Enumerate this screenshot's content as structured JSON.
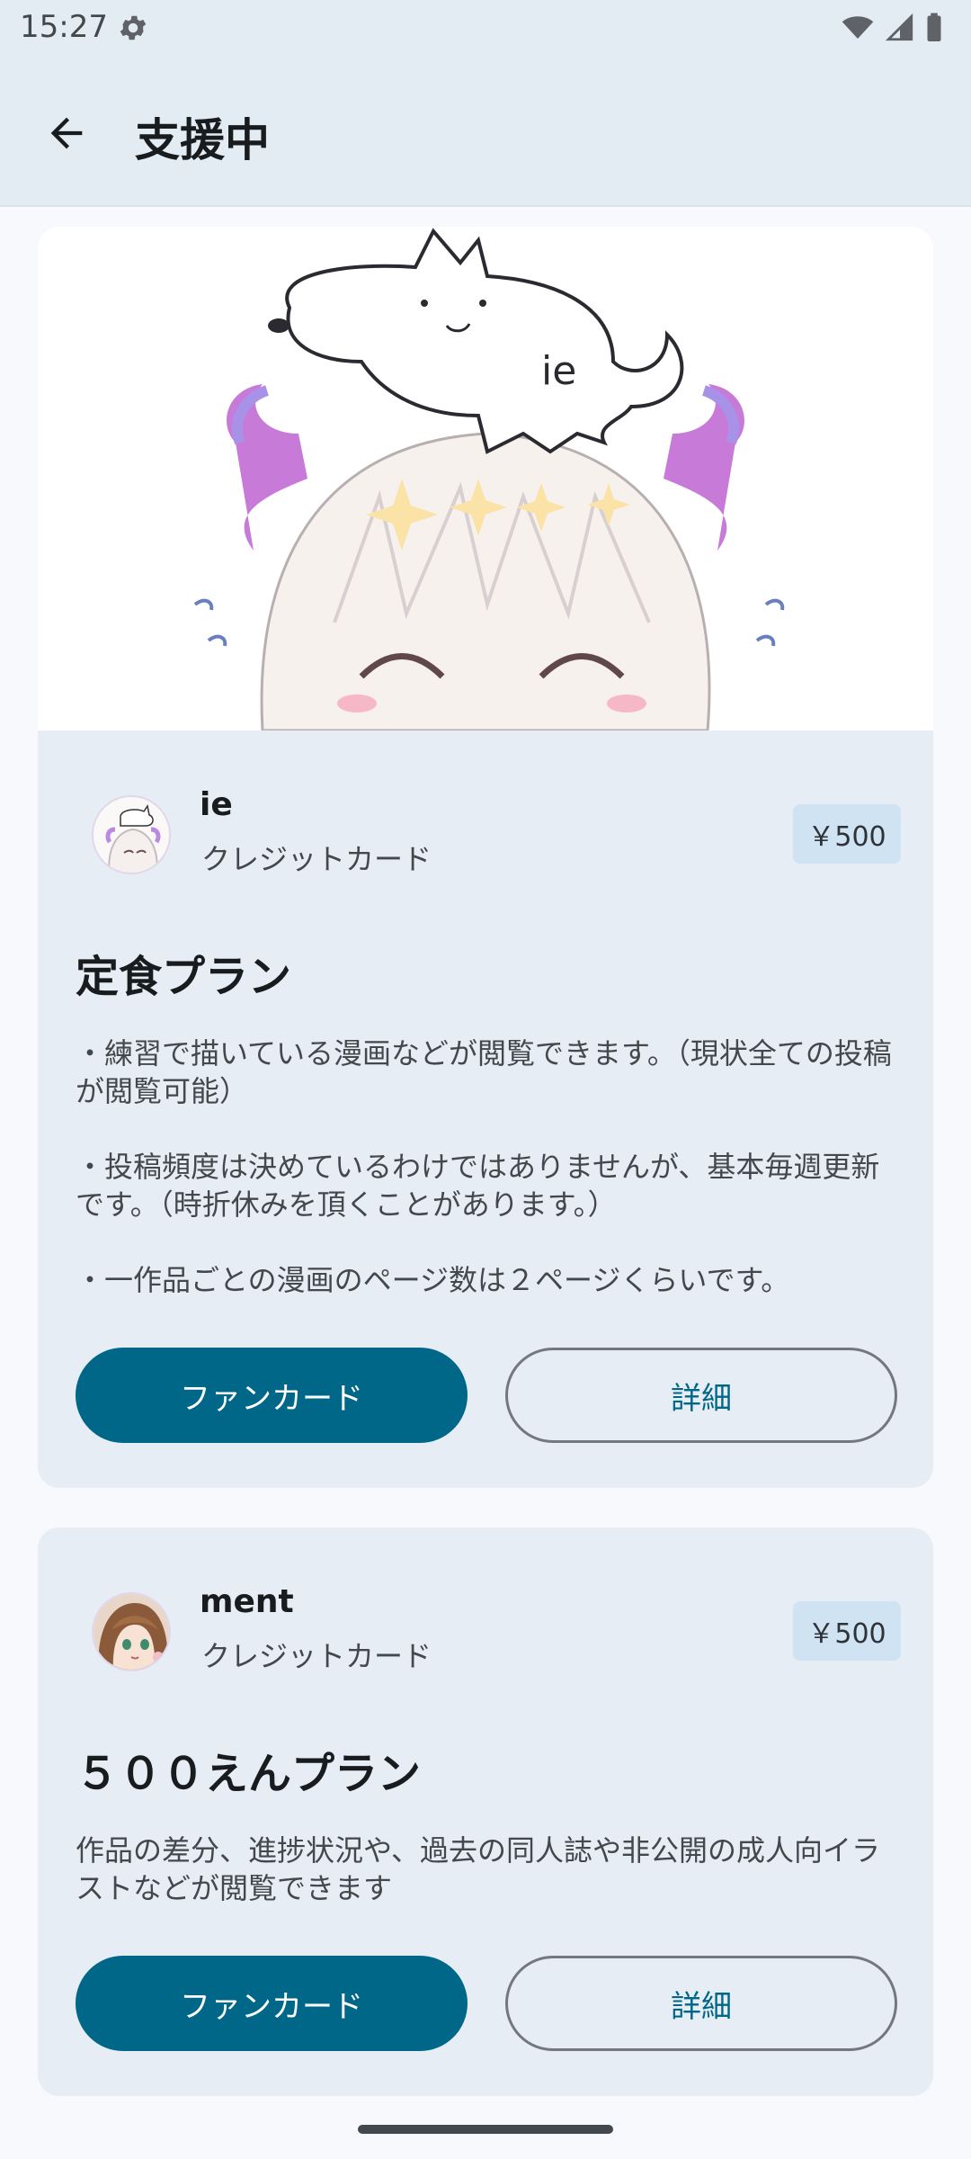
{
  "status_bar": {
    "time": "15:27",
    "icons": [
      "gear-icon",
      "wifi-icon",
      "signal-icon",
      "battery-icon"
    ]
  },
  "app_bar": {
    "title": "支援中",
    "back_icon": "arrow-back-icon"
  },
  "subscriptions": [
    {
      "creator_name": "ie",
      "payment_method": "クレジットカード",
      "price": "￥500",
      "plan_title": "定食プラン",
      "description": "・練習で描いている漫画などが閲覧できます。（現状全ての投稿が閲覧可能）\n\n・投稿頻度は決めているわけではありませんが、基本毎週更新です。（時折休みを頂くことがあります。）\n\n・一作品ごとの漫画のページ数は２ページくらいです。",
      "primary_button": "ファンカード",
      "secondary_button": "詳細",
      "banner_text": "ie"
    },
    {
      "creator_name": "ment",
      "payment_method": "クレジットカード",
      "price": "￥500",
      "plan_title": "５００えんプラン",
      "description": "作品の差分、進捗状況や、過去の同人誌や非公開の成人向イラストなどが閲覧できます",
      "primary_button": "ファンカード",
      "secondary_button": "詳細"
    }
  ],
  "colors": {
    "primary": "#006789",
    "surface": "#e6edf4",
    "badge": "#cfe3f3",
    "app_bar": "#e4ecf3"
  }
}
